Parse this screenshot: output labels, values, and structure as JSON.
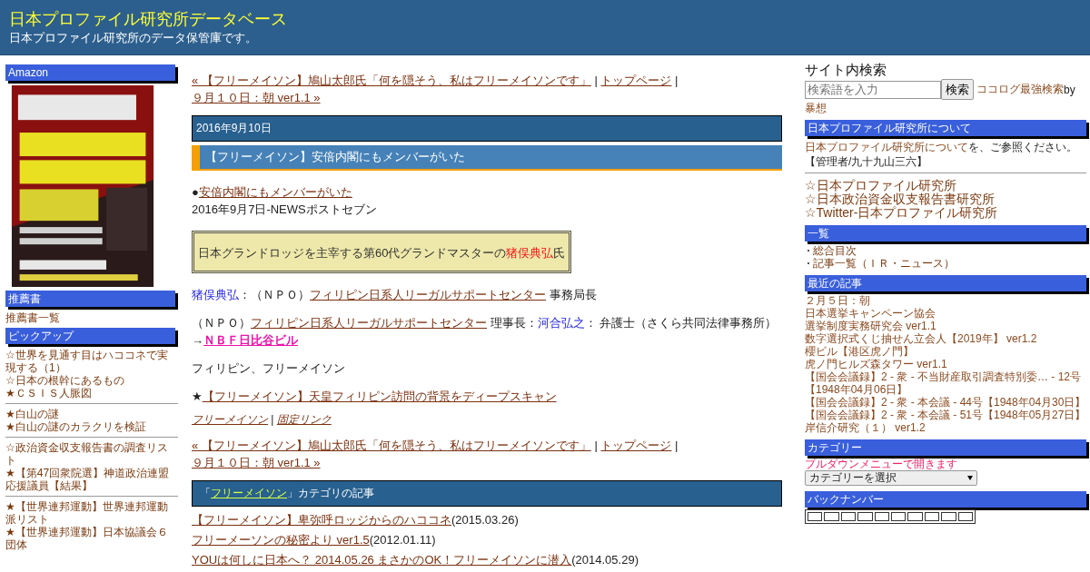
{
  "header": {
    "title": "日本プロファイル研究所データベース",
    "subtitle": "日本プロファイル研究所のデータ保管庫です。"
  },
  "left_sidebar": [
    {
      "heading": "Amazon",
      "kind": "picture"
    },
    {
      "heading": "推薦書",
      "kind": "links",
      "groups": [
        [
          "推薦書一覧"
        ]
      ]
    },
    {
      "heading": "ピックアップ",
      "kind": "links",
      "groups": [
        [
          "☆世界を見通す目はハココネで実現する（1）",
          "☆日本の根幹にあるもの",
          "★ＣＳＩＳ人脈図"
        ],
        [
          "★白山の謎",
          "★白山の謎のカラクリを検証"
        ],
        [
          "☆政治資金収支報告書の調査リスト",
          "★【第47回衆院選】神道政治連盟応援議員【結果】"
        ],
        [
          "★【世界連邦運動】世界連邦運動派リスト",
          "★【世界連邦運動】日本協議会６団体"
        ]
      ]
    }
  ],
  "main": {
    "nav_top": {
      "prev": "« 【フリーメイソン】鳩山太郎氏「何を隠そう、私はフリーメイソンです」",
      "separator": "|",
      "home": "トップページ",
      "separator_2": "|",
      "next": "９月１０日：朝 ver1.1 »"
    },
    "date": "2016年9月10日",
    "entry_title": "【フリーメイソン】安倍内閣にもメンバーがいた",
    "body": [
      {
        "kind": "lines",
        "lines": [
          [
            {
              "kind": "text",
              "text": "●"
            },
            {
              "kind": "link",
              "text": "安倍内閣にもメンバーがいた"
            }
          ],
          [
            {
              "kind": "text",
              "text": "2016年9月7日-NEWSポストセブン"
            }
          ]
        ]
      },
      {
        "kind": "box",
        "lines": [
          [
            {
              "kind": "text",
              "text": "日本グランドロッジを主宰する第60代グランドマスターの"
            },
            {
              "kind": "red",
              "text": "猪俣典弘"
            },
            {
              "kind": "text",
              "text": "氏"
            }
          ]
        ]
      },
      {
        "kind": "lines",
        "lines": [
          [
            {
              "kind": "name",
              "text": "猪俣典弘"
            },
            {
              "kind": "text",
              "text": "：（ＮＰＯ）"
            },
            {
              "kind": "link",
              "text": "フィリピン日系人リーガルサポートセンター"
            },
            {
              "kind": "text",
              "text": " 事務局長"
            }
          ]
        ]
      },
      {
        "kind": "lines",
        "lines": [
          [
            {
              "kind": "text",
              "text": "（ＮＰＯ）"
            },
            {
              "kind": "link",
              "text": "フィリピン日系人リーガルサポートセンター"
            },
            {
              "kind": "text",
              "text": " 理事長："
            },
            {
              "kind": "name",
              "text": "河合弘之"
            },
            {
              "kind": "text",
              "text": "： 弁護士（さくら共同法律事務所）"
            }
          ],
          [
            {
              "kind": "text",
              "text": "→"
            },
            {
              "kind": "strong",
              "text": "ＮＢＦ日比谷ビル"
            }
          ]
        ]
      },
      {
        "kind": "lines",
        "lines": [
          [
            {
              "kind": "text",
              "text": "フィリピン、フリーメイソン"
            }
          ]
        ]
      },
      {
        "kind": "lines",
        "lines": [
          [
            {
              "kind": "text",
              "text": "★"
            },
            {
              "kind": "link",
              "text": "【フリーメイソン】天皇フィリピン訪問の背景をディープスキャン"
            }
          ]
        ]
      }
    ],
    "entry_footer": {
      "category": "フリーメイソン",
      "separator": "|",
      "permalink": "固定リンク"
    },
    "nav_bottom": {
      "prev": "« 【フリーメイソン】鳩山太郎氏「何を隠そう、私はフリーメイソンです」",
      "separator": "|",
      "home": "トップページ",
      "separator_2": "|",
      "next": "９月１０日：朝 ver1.1 »"
    },
    "category_heading": {
      "open": "「",
      "link": "フリーメイソン",
      "close": "」カテゴリの記事"
    },
    "category_articles": [
      {
        "title": "【フリーメイソン】卑弥呼ロッジからのハココネ",
        "date": "(2015.03.26)"
      },
      {
        "title": "フリーメーソンの秘密より ver1.5",
        "date": "(2012.01.11)"
      },
      {
        "title": "YOUは何しに日本へ？ 2014.05.26 まさかのOK！フリーメイソンに潜入",
        "date": "(2014.05.29)"
      }
    ]
  },
  "right_sidebar": {
    "search": {
      "heading": "サイト内検索",
      "placeholder": "検索語を入力",
      "button": "検索",
      "credit_link": "ココログ最強検索",
      "credit_by": " by",
      "credit_author": "暴想"
    },
    "about": {
      "heading": "日本プロファイル研究所について",
      "link": "日本プロファイル研究所について",
      "text": "を、ご参照ください。",
      "admin": "【管理者/九十九山三六】"
    },
    "sites": [
      "☆日本プロファイル研究所",
      "☆日本政治資金収支報告書研究所",
      "☆Twitter-日本プロファイル研究所"
    ],
    "index": {
      "heading": "一覧",
      "items": [
        "総合目次",
        "記事一覧（ＩＲ・ニュース）"
      ]
    },
    "recent": {
      "heading": "最近の記事",
      "items": [
        "２月５日：朝",
        "日本選挙キャンペーン協会",
        "選挙制度実務研究会 ver1.1",
        "数字選択式くじ抽せん立会人【2019年】 ver1.2",
        "櫻ビル【港区虎ノ門】",
        "虎ノ門ヒルズ森タワー ver1.1",
        "【国会会議録】2 - 衆 - 不当財産取引調査特別委… - 12号【1948年04月06日】",
        "【国会会議録】2 - 衆 - 本会議 - 44号【1948年04月30日】",
        "【国会会議録】2 - 衆 - 本会議 - 51号【1948年05月27日】",
        "岸信介研究（１） ver1.2"
      ]
    },
    "categories": {
      "heading": "カテゴリー",
      "note": "プルダウンメニューで開きます",
      "select": "カテゴリーを選択"
    },
    "back_numbers": {
      "heading": "バックナンバー"
    }
  }
}
